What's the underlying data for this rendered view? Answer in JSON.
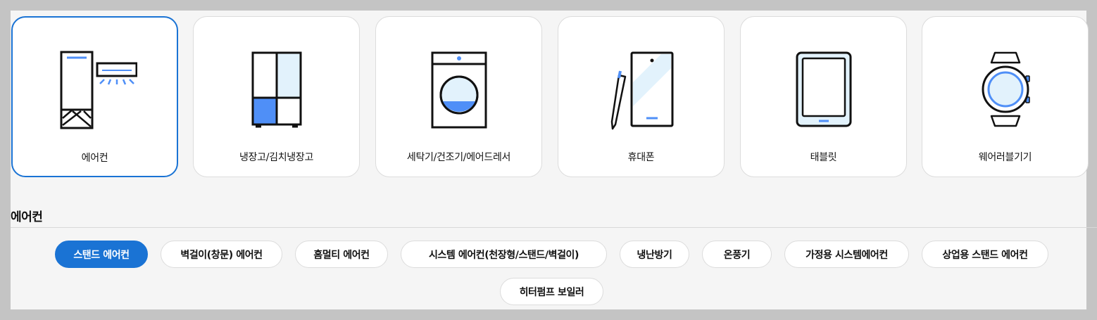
{
  "colors": {
    "accent": "#1a73d4",
    "icon_fill_light": "#e2f2fc",
    "icon_fill_blue": "#4f8ff7",
    "page_background": "#f5f5f5"
  },
  "categories": [
    {
      "label": "에어컨",
      "icon": "air-conditioner-icon",
      "selected": true
    },
    {
      "label": "냉장고/김치냉장고",
      "icon": "refrigerator-icon",
      "selected": false
    },
    {
      "label": "세탁기/건조기/에어드레서",
      "icon": "washing-machine-icon",
      "selected": false
    },
    {
      "label": "휴대폰",
      "icon": "smartphone-icon",
      "selected": false
    },
    {
      "label": "태블릿",
      "icon": "tablet-icon",
      "selected": false
    },
    {
      "label": "웨어러블기기",
      "icon": "smartwatch-icon",
      "selected": false
    }
  ],
  "section": {
    "title": "에어컨"
  },
  "subcategories": [
    {
      "label": "스탠드 에어컨",
      "selected": true
    },
    {
      "label": "벽걸이(창문) 에어컨",
      "selected": false
    },
    {
      "label": "홈멀티 에어컨",
      "selected": false
    },
    {
      "label": "시스템 에어컨(천장형/스탠드/벽걸이)",
      "selected": false
    },
    {
      "label": "냉난방기",
      "selected": false
    },
    {
      "label": "온풍기",
      "selected": false
    },
    {
      "label": "가정용 시스템에어컨",
      "selected": false
    },
    {
      "label": "상업용 스탠드 에어컨",
      "selected": false
    },
    {
      "label": "히터펌프 보일러",
      "selected": false
    }
  ]
}
